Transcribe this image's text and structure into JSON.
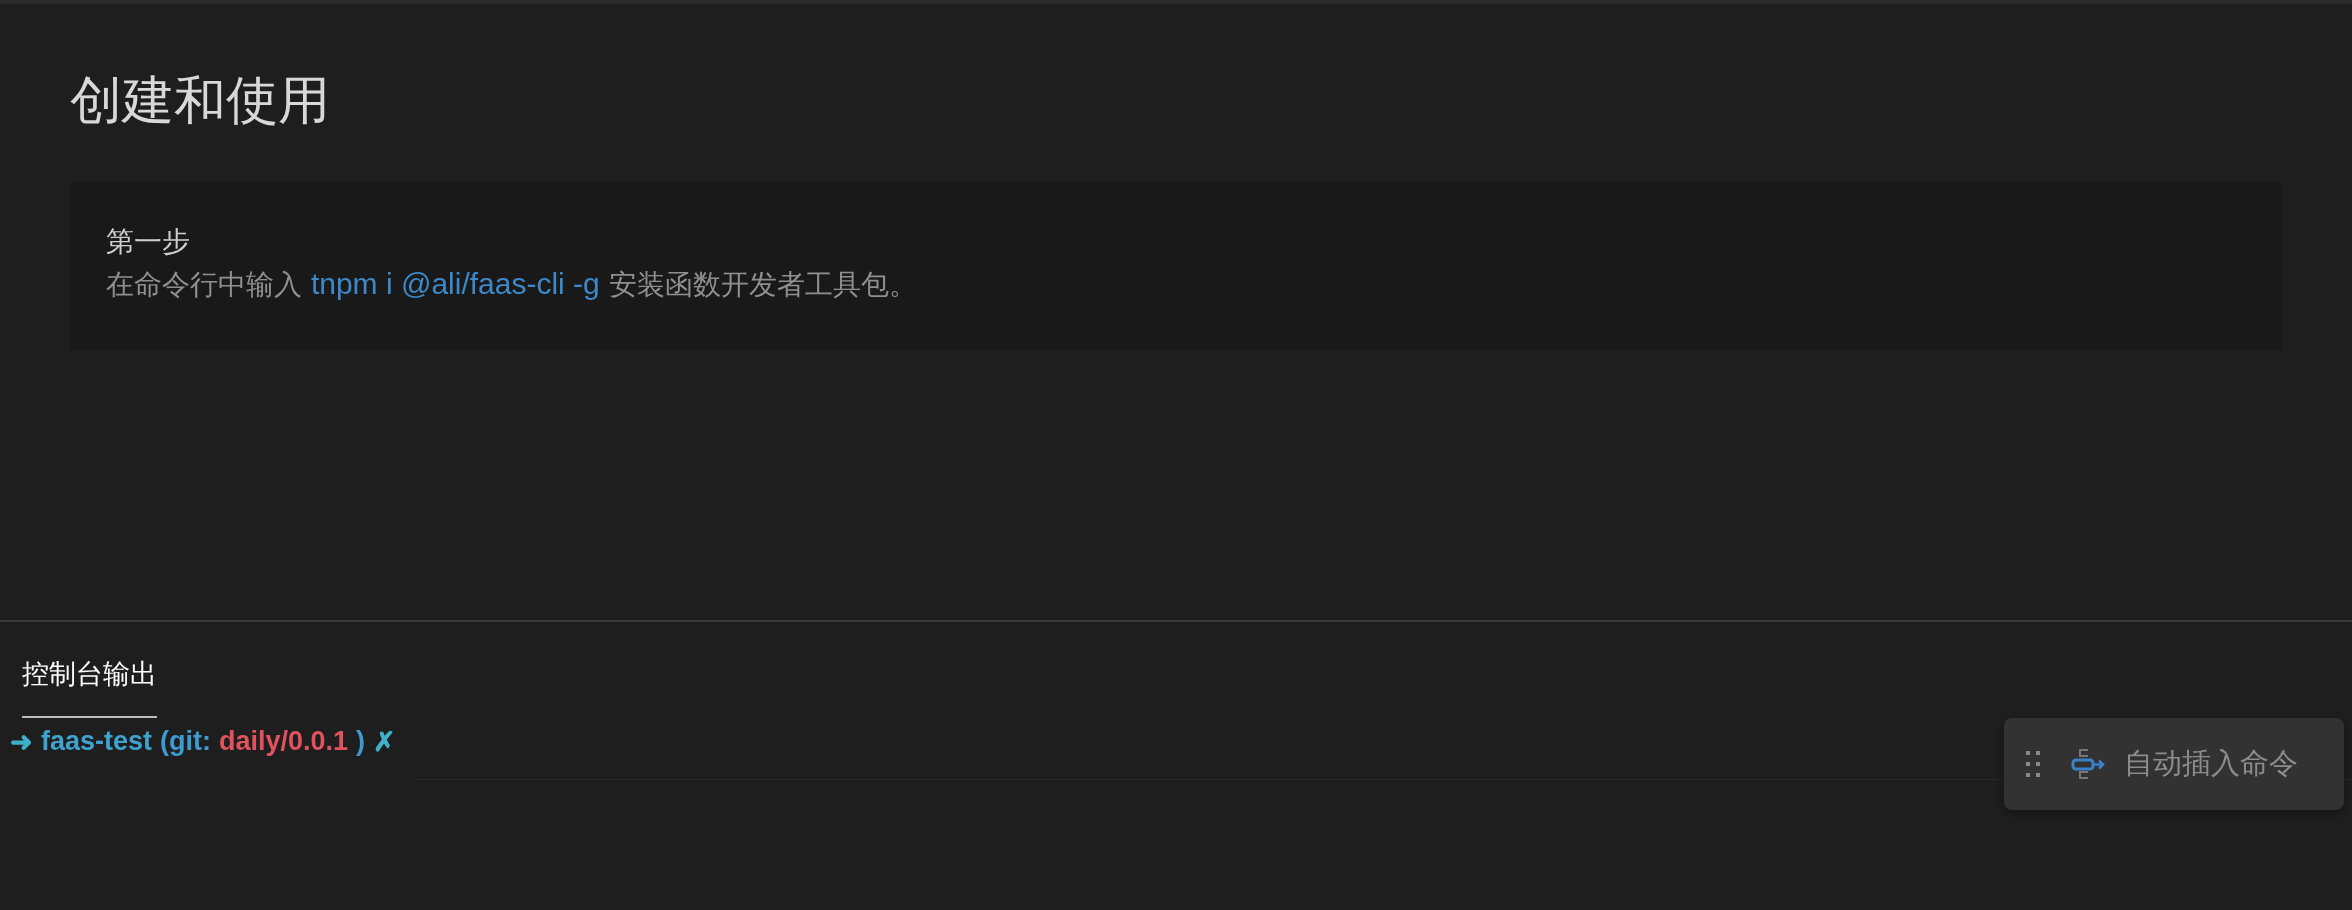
{
  "title": "创建和使用",
  "step": {
    "label": "第一步",
    "text_before": "在命令行中输入",
    "command": "tnpm i @ali/faas-cli -g",
    "text_after": "安装函数开发者工具包。"
  },
  "console_tabs": [
    {
      "label": "控制台输出",
      "selected": true
    }
  ],
  "prompt": [
    {
      "text": "➜",
      "color": "#3fb0c8"
    },
    {
      "text": "faas-test",
      "color": "#3fa3cf"
    },
    {
      "text": "(git:",
      "color": "#3f9ad0"
    },
    {
      "text": "daily/0.0.1",
      "color": "#e0525e"
    },
    {
      "text": ")",
      "color": "#3f9ad0"
    },
    {
      "text": "✗",
      "color": "#3fb0c8"
    }
  ],
  "insert_button": {
    "label": "自动插入命令"
  }
}
